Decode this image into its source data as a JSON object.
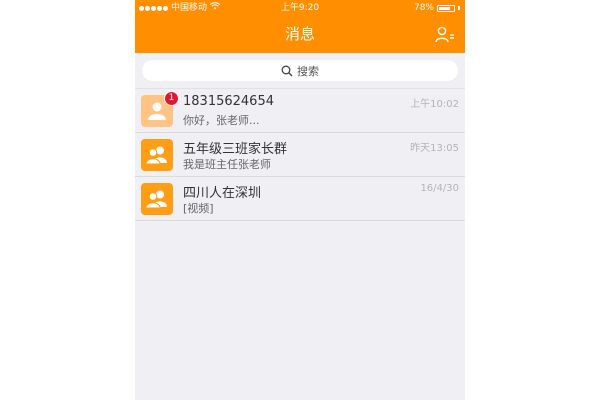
{
  "status_bar": {
    "carrier": "中国移动",
    "time": "上午9:20",
    "battery": "78%",
    "battery_level": 0.78
  },
  "nav": {
    "title": "消息",
    "contacts_icon": "contacts-icon"
  },
  "search": {
    "label": "搜索",
    "icon": "search-icon"
  },
  "conversations": [
    {
      "title": "18315624654",
      "preview": "你好，张老师...",
      "time": "上午10:02",
      "unread": "1",
      "avatar_icon": "person-icon"
    },
    {
      "title": "五年级三班家长群",
      "preview": "我是班主任张老师",
      "time": "昨天13:05",
      "avatar_icon": "group-icon"
    },
    {
      "title": "四川人在深圳",
      "preview": "[视频]",
      "time": "16/4/30",
      "avatar_icon": "group-icon"
    }
  ],
  "colors": {
    "accent": "#ff8f00",
    "background": "#efeff4",
    "badge": "#e0182f"
  }
}
